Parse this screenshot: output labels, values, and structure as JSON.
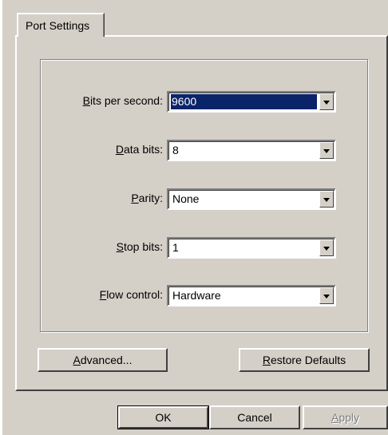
{
  "tabs": [
    {
      "label": "Port Settings"
    }
  ],
  "fields": {
    "bits_per_second": {
      "label_hot": "B",
      "label_rest": "its per second:",
      "value": "9600"
    },
    "data_bits": {
      "label_hot": "D",
      "label_rest": "ata bits:",
      "value": "8"
    },
    "parity": {
      "label_hot": "P",
      "label_rest": "arity:",
      "value": "None"
    },
    "stop_bits": {
      "label_hot": "S",
      "label_rest": "top bits:",
      "value": "1"
    },
    "flow_control": {
      "label_hot": "F",
      "label_rest": "low control:",
      "value": "Hardware"
    }
  },
  "buttons": {
    "advanced": {
      "hot": "A",
      "rest": "dvanced..."
    },
    "restore": {
      "hot": "R",
      "rest": "estore Defaults"
    },
    "ok": "OK",
    "cancel": "Cancel",
    "apply": {
      "hot": "A",
      "rest": "pply"
    }
  },
  "colors": {
    "face": "#d4d0c8",
    "selection": "#0a246a"
  }
}
